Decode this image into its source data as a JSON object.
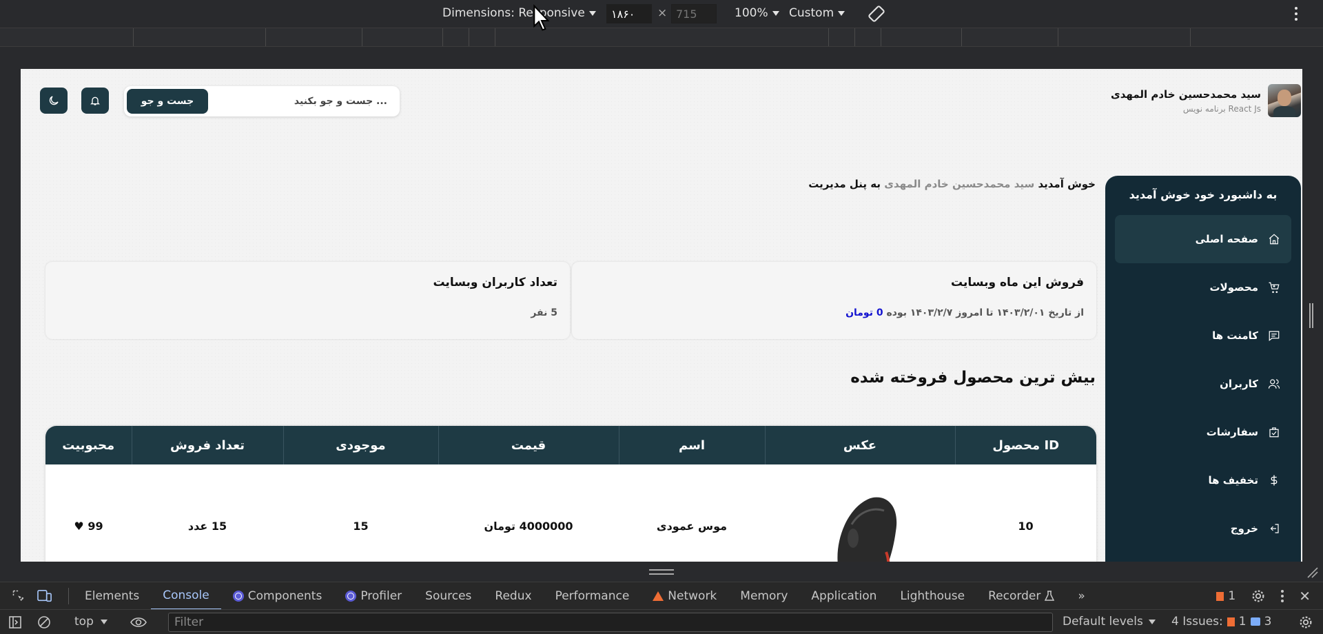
{
  "devtools_toolbar": {
    "dimensions_label": "Dimensions: Responsive",
    "width_value": "۱۸۶۰",
    "height_placeholder": "715",
    "zoom": "100%",
    "throttle": "Custom"
  },
  "header": {
    "user_name": "سید محمدحسین خادم المهدی",
    "user_role": "برنامه نویس React Js",
    "search_placeholder": "جست و جو بکنید ...",
    "search_button": "جست و جو"
  },
  "sidebar": {
    "title": "به داشبورد خود خوش آمدید",
    "items": [
      {
        "label": "صفحه اصلی",
        "icon": "home-icon"
      },
      {
        "label": "محصولات",
        "icon": "cart-icon"
      },
      {
        "label": "کامنت ها",
        "icon": "comment-icon"
      },
      {
        "label": "کاربران",
        "icon": "users-icon"
      },
      {
        "label": "سفارشات",
        "icon": "bag-icon"
      },
      {
        "label": "تخفیف ها",
        "icon": "dollar-icon"
      },
      {
        "label": "خروج",
        "icon": "logout-icon"
      }
    ]
  },
  "welcome": {
    "prefix": "خوش آمدید",
    "name": "سید محمدحسین خادم المهدی",
    "suffix": "به پنل مدیریت"
  },
  "cards": {
    "sales_title": "فروش این ماه وبسایت",
    "sales_text": "از تاریخ ۱۴۰۳/۲/۰۱ تا امروز ۱۴۰۳/۲/۷ بوده",
    "sales_amount": "0 تومان",
    "users_title": "تعداد کاربران وبسایت",
    "users_value": "5 نفر"
  },
  "section_title": "بیش ترین محصول فروخته شده",
  "table": {
    "headers": [
      "ID محصول",
      "عکس",
      "اسم",
      "قیمت",
      "موجودی",
      "تعداد فروش",
      "محبوبیت"
    ],
    "rows": [
      {
        "id": "10",
        "name": "موس عمودی",
        "price": "4000000 تومان",
        "stock": "15",
        "sold": "15 عدد",
        "popularity": "99 ♥"
      }
    ]
  },
  "devtools_tabs": {
    "items": [
      "Elements",
      "Console",
      "Components",
      "Profiler",
      "Sources",
      "Redux",
      "Performance",
      "Network",
      "Memory",
      "Application",
      "Lighthouse",
      "Recorder"
    ],
    "warning_count": "1"
  },
  "console_bar": {
    "context": "top",
    "filter_placeholder": "Filter",
    "levels": "Default levels",
    "issues_label": "4 Issues:",
    "issues_warn": "1",
    "issues_info": "3"
  },
  "colors": {
    "primary": "#1e3a44",
    "sidebar": "#132a36",
    "accent_blue": "#1414d0"
  }
}
